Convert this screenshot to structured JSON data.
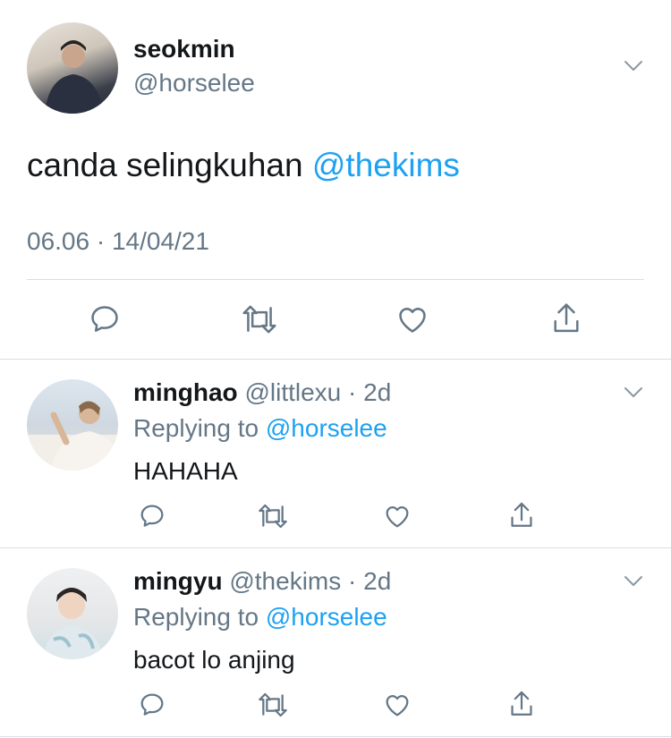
{
  "main_tweet": {
    "display_name": "seokmin",
    "handle": "@horselee",
    "text": "canda selingkuhan ",
    "mention": "@thekims",
    "timestamp": "06.06 · 14/04/21",
    "actions": [
      "reply-icon",
      "retweet-icon",
      "like-icon",
      "share-icon"
    ]
  },
  "replies": [
    {
      "display_name": "minghao",
      "handle": "@littlexu",
      "time": " · 2d",
      "replying_prefix": "Replying to ",
      "replying_to": "@horselee",
      "text": "HAHAHA"
    },
    {
      "display_name": "mingyu",
      "handle": "@thekims",
      "time": " · 2d",
      "replying_prefix": "Replying to ",
      "replying_to": "@horselee",
      "text": "bacot lo anjing"
    }
  ],
  "colors": {
    "accent": "#1da1f2",
    "secondary_text": "#657786",
    "primary_text": "#14171a",
    "divider": "#d8dee3"
  }
}
